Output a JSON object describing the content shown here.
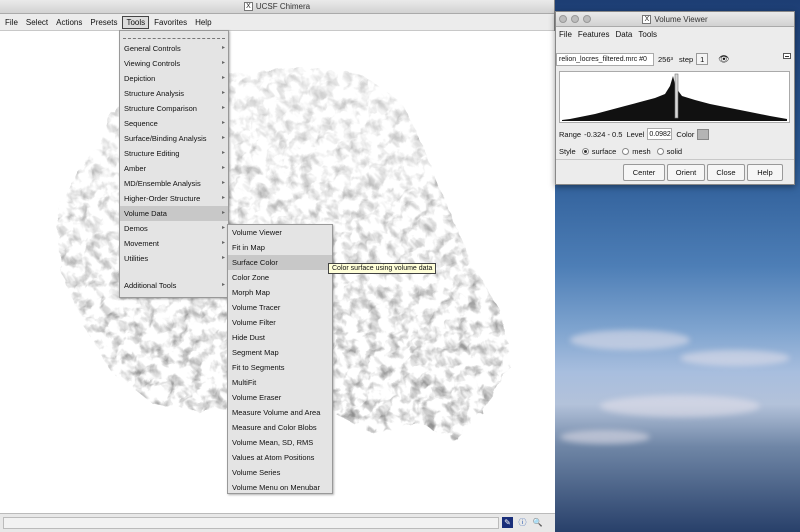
{
  "main_window": {
    "title": "UCSF Chimera",
    "menus": [
      "File",
      "Select",
      "Actions",
      "Presets",
      "Tools",
      "Favorites",
      "Help"
    ]
  },
  "tools_menu": {
    "items": [
      {
        "label": "General Controls"
      },
      {
        "label": "Viewing Controls"
      },
      {
        "label": "Depiction"
      },
      {
        "label": "Structure Analysis"
      },
      {
        "label": "Structure Comparison"
      },
      {
        "label": "Sequence"
      },
      {
        "label": "Surface/Binding Analysis"
      },
      {
        "label": "Structure Editing"
      },
      {
        "label": "Amber"
      },
      {
        "label": "MD/Ensemble Analysis"
      },
      {
        "label": "Higher-Order Structure"
      },
      {
        "label": "Volume Data"
      },
      {
        "label": "Demos"
      },
      {
        "label": "Movement"
      },
      {
        "label": "Utilities"
      }
    ],
    "extra": "Additional Tools"
  },
  "volume_data_menu": {
    "items": [
      "Volume Viewer",
      "Fit in Map",
      "Surface Color",
      "Color Zone",
      "Morph Map",
      "Volume Tracer",
      "Volume Filter",
      "Hide Dust",
      "Segment Map",
      "Fit to Segments",
      "MultiFit",
      "Volume Eraser",
      "Measure Volume and Area",
      "Measure and Color Blobs",
      "Volume Mean, SD, RMS",
      "Values at Atom Positions",
      "Volume Series",
      "Volume Menu on Menubar"
    ]
  },
  "tooltip": "Color surface using volume data",
  "volume_viewer": {
    "title": "Volume Viewer",
    "menus": [
      "File",
      "Features",
      "Data",
      "Tools"
    ],
    "filename": "relion_locres_filtered.mrc #0",
    "size": "256³",
    "step_label": "step",
    "step_value": "1",
    "range_label": "Range",
    "range_value": "-0.324 - 0.5",
    "level_label": "Level",
    "level_value": "0.0982",
    "color_label": "Color",
    "style_label": "Style",
    "styles": [
      "surface",
      "mesh",
      "solid"
    ],
    "selected_style": "surface",
    "buttons": [
      "Center",
      "Orient",
      "Close",
      "Help"
    ]
  }
}
